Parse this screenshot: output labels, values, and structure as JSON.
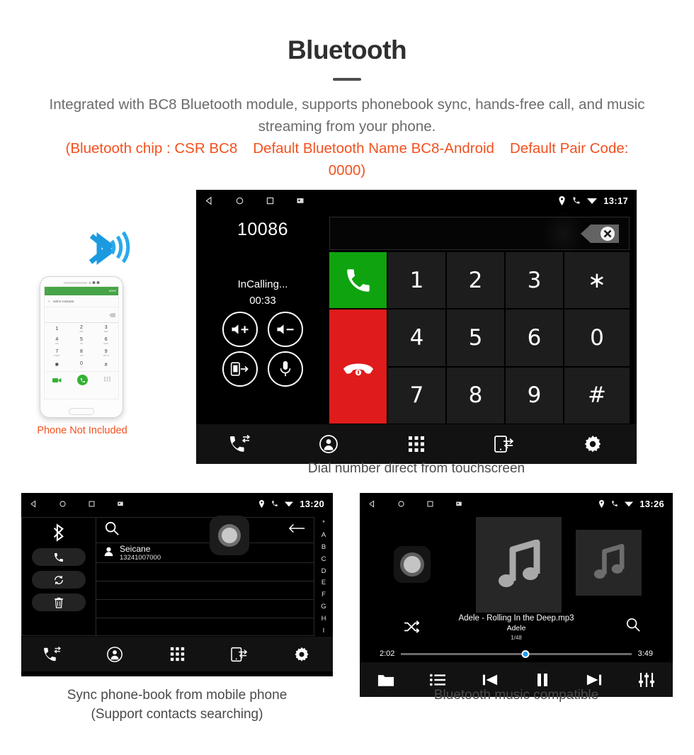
{
  "header": {
    "title": "Bluetooth",
    "intro": "Integrated with BC8 Bluetooth module, supports phonebook sync, hands-free call, and music streaming from your phone.",
    "spec_chip": "(Bluetooth chip : CSR BC8",
    "spec_name": "Default Bluetooth Name BC8-Android",
    "spec_pair": "Default Pair Code: 0000)",
    "accent_color": "#f4511e",
    "body_color": "#6b6b6b"
  },
  "phone_illustration": {
    "note": "Phone Not Included",
    "bt_icon": "bluetooth-icon",
    "screen": {
      "appbar_back": "←",
      "appbar_more": "MORE",
      "add_contact": "Add to Contacts",
      "keys": [
        {
          "digit": "1",
          "letters": ""
        },
        {
          "digit": "2",
          "letters": "ABC"
        },
        {
          "digit": "3",
          "letters": "DEF"
        },
        {
          "digit": "4",
          "letters": "GHI"
        },
        {
          "digit": "5",
          "letters": "JKL"
        },
        {
          "digit": "6",
          "letters": "MNO"
        },
        {
          "digit": "7",
          "letters": "PQRS"
        },
        {
          "digit": "8",
          "letters": "TUV"
        },
        {
          "digit": "9",
          "letters": "WXYZ"
        },
        {
          "digit": "✱",
          "letters": ""
        },
        {
          "digit": "0",
          "letters": "+"
        },
        {
          "digit": "#",
          "letters": ""
        }
      ]
    }
  },
  "dialer": {
    "caption": "Dial number direct from touchscreen",
    "statusbar": {
      "time": "13:17",
      "nav_icons": [
        "back-icon",
        "home-icon",
        "recents-icon",
        "screenshot-icon"
      ],
      "status_icons": [
        "location-icon",
        "phone-icon",
        "wifi-icon"
      ]
    },
    "number": "10086",
    "call_state": "InCalling...",
    "call_timer": "00:33",
    "controls": [
      "volume-up-icon",
      "volume-down-icon",
      "transfer-audio-icon",
      "mute-mic-icon"
    ],
    "keypad": [
      "1",
      "2",
      "3",
      "∗",
      "4",
      "5",
      "6",
      "0",
      "7",
      "8",
      "9",
      "#"
    ],
    "answer_icon": "call-answer-icon",
    "hangup_icon": "call-end-icon",
    "backspace_icon": "backspace-icon",
    "navbar": [
      "call-log-icon",
      "contacts-icon",
      "keypad-icon",
      "sync-device-icon",
      "settings-icon"
    ],
    "accent_green": "#0fa30f",
    "accent_red": "#e01b1b"
  },
  "phonebook": {
    "caption_line1": "Sync phone-book from mobile phone",
    "caption_line2": "(Support contacts searching)",
    "statusbar": {
      "time": "13:20",
      "nav_icons": [
        "back-icon",
        "home-icon",
        "recents-icon",
        "screenshot-icon"
      ],
      "status_icons": [
        "location-icon",
        "phone-icon",
        "wifi-icon"
      ]
    },
    "side_icons": [
      "bluetooth-icon",
      "dial-icon",
      "sync-icon",
      "delete-icon"
    ],
    "search_placeholder": "",
    "search_icon": "search-icon",
    "back_arrow_icon": "back-arrow-icon",
    "contacts": [
      {
        "name": "Seicane",
        "number": "13241007000"
      }
    ],
    "empty_rows": 3,
    "alphabet_index": [
      "*",
      "A",
      "B",
      "C",
      "D",
      "E",
      "F",
      "G",
      "H",
      "I"
    ],
    "navbar": [
      "call-log-icon",
      "contacts-icon",
      "keypad-icon",
      "sync-device-icon",
      "settings-icon"
    ]
  },
  "music": {
    "caption": "Bluetooth music compatible",
    "statusbar": {
      "time": "13:26",
      "nav_icons": [
        "back-icon",
        "home-icon",
        "recents-icon",
        "screenshot-icon"
      ],
      "status_icons": [
        "location-icon",
        "phone-icon",
        "wifi-icon"
      ]
    },
    "track_title": "Adele - Rolling In the Deep.mp3",
    "artist": "Adele",
    "track_count": "1/48",
    "elapsed": "2:02",
    "duration": "3:49",
    "progress_percent": 54,
    "shuffle_icon": "shuffle-icon",
    "search_icon": "search-icon",
    "navbar": [
      "folder-icon",
      "playlist-icon",
      "previous-icon",
      "pause-icon",
      "next-icon",
      "equalizer-icon"
    ],
    "progress_color": "#1d9bf0"
  }
}
